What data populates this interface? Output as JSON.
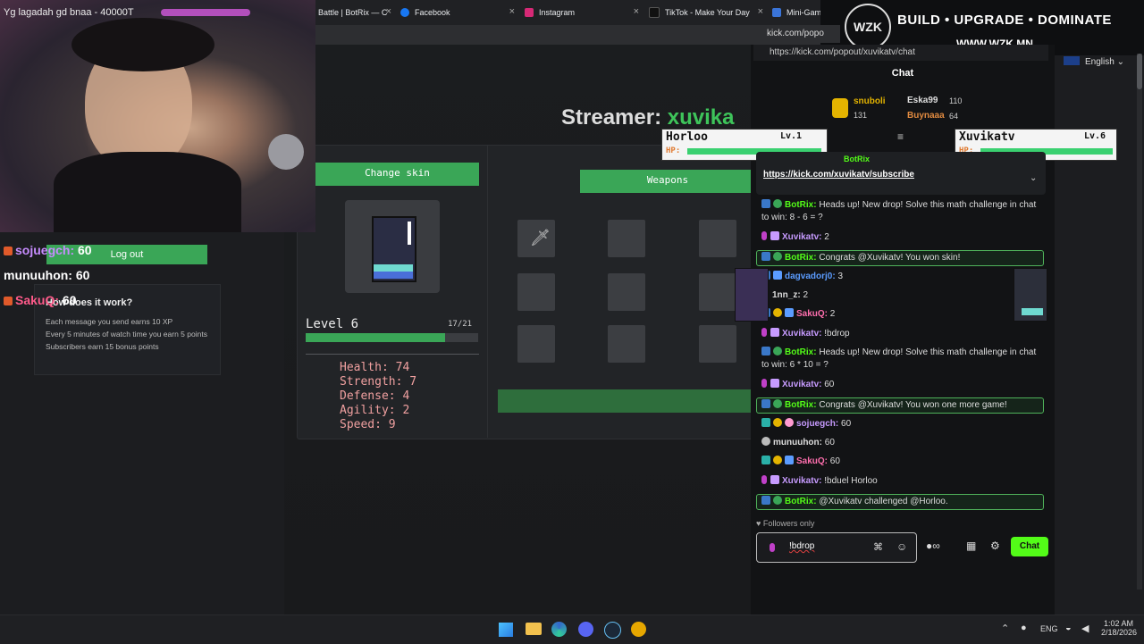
{
  "stream_overlay": {
    "top_ticker": "Yg lagadah gd bnaa - 40000T",
    "brand_tagline": "BUILD • UPGRADE • DOMINATE",
    "brand_url": "WWW.WZK.MN",
    "brand_logo": "WZK",
    "leaderboard": [
      {
        "user": "sojuegch:",
        "score": "60"
      },
      {
        "user": "munuuhon:",
        "score": "60"
      },
      {
        "user": "SakuQ:",
        "score": "60"
      }
    ],
    "logout_label": "Log out",
    "how_title": "How does it work?",
    "how_lines": [
      "Each message you send earns 10 XP",
      "Every 5 minutes of watch time you earn 5 points",
      "Subscribers earn 15 bonus points"
    ]
  },
  "browser": {
    "tabs": [
      {
        "label": "Battle | BotRix — C"
      },
      {
        "label": "Facebook"
      },
      {
        "label": "Instagram"
      },
      {
        "label": "TikTok - Make Your Day"
      },
      {
        "label": "Mini-Game"
      }
    ],
    "popup_url_title": "kick.com/popo",
    "popup_url": "https://kick.com/popout/xuvikatv/chat",
    "language": "English"
  },
  "game": {
    "streamer_label": "Streamer:",
    "streamer_name": "xuvika",
    "change_skin_label": "Change skin",
    "weapons_label": "Weapons",
    "level_label": "Level 6",
    "xp_text": "17/21",
    "xp_fraction": 0.81,
    "stats": [
      {
        "label": "Health: 74"
      },
      {
        "label": "Strength: 7"
      },
      {
        "label": "Defense: 4"
      },
      {
        "label": "Agility: 2"
      },
      {
        "label": "Speed: 9"
      }
    ]
  },
  "duel": {
    "left": {
      "name": "Horloo",
      "level": "Lv.1",
      "hp_label": "HP:"
    },
    "right": {
      "name": "Xuvikatv",
      "level": "Lv.6",
      "hp_label": "HP:"
    }
  },
  "chat": {
    "title": "Chat",
    "top_gifters": [
      {
        "name": "snuboli",
        "count": "131"
      },
      {
        "name": "Eska99",
        "count": "110"
      },
      {
        "name": "Buynaaa",
        "count": "64"
      }
    ],
    "pinned_by": "BotRix",
    "pinned_link": "https://kick.com/xuvikatv/subscribe",
    "messages": [
      {
        "user": "BotRix:",
        "text": "Heads up! New drop! Solve this math challenge in chat to win: 8 - 6 = ?",
        "color": "#53fc18"
      },
      {
        "user": "Xuvikatv:",
        "text": "2",
        "color": "#c79bff"
      },
      {
        "user": "BotRix:",
        "text": "Congrats @Xuvikatv! You won skin!",
        "color": "#53fc18"
      },
      {
        "user": "dagvadorj0:",
        "text": "3",
        "color": "#5b9cff"
      },
      {
        "user": "1nn_z:",
        "text": "2",
        "color": "#dddddd"
      },
      {
        "user": "SakuQ:",
        "text": "2",
        "color": "#ff6fae"
      },
      {
        "user": "Xuvikatv:",
        "text": "!bdrop",
        "color": "#c79bff"
      },
      {
        "user": "BotRix:",
        "text": "Heads up! New drop! Solve this math challenge in chat to win: 6 * 10 = ?",
        "color": "#53fc18"
      },
      {
        "user": "Xuvikatv:",
        "text": "60",
        "color": "#c79bff"
      },
      {
        "user": "BotRix:",
        "text": "Congrats @Xuvikatv! You won one more game!",
        "color": "#53fc18"
      },
      {
        "user": "sojuegch:",
        "text": "60",
        "color": "#c79bff"
      },
      {
        "user": "munuuhon:",
        "text": "60",
        "color": "#dddddd"
      },
      {
        "user": "SakuQ:",
        "text": "60",
        "color": "#ff6fae"
      },
      {
        "user": "Xuvikatv:",
        "text": "!bduel Horloo",
        "color": "#c79bff"
      },
      {
        "user": "BotRix:",
        "text": "@Xuvikatv challenged @Horloo.",
        "color": "#53fc18"
      }
    ],
    "followers_only": "Followers only",
    "input_value": "!bdrop",
    "send_label": "Chat"
  },
  "taskbar": {
    "lang": "ENG",
    "time": "1:02 AM",
    "date": "2/18/2026"
  },
  "colors": {
    "kick_green": "#53fc18",
    "game_green": "#3aa657",
    "accent_purple": "#c040c8"
  }
}
